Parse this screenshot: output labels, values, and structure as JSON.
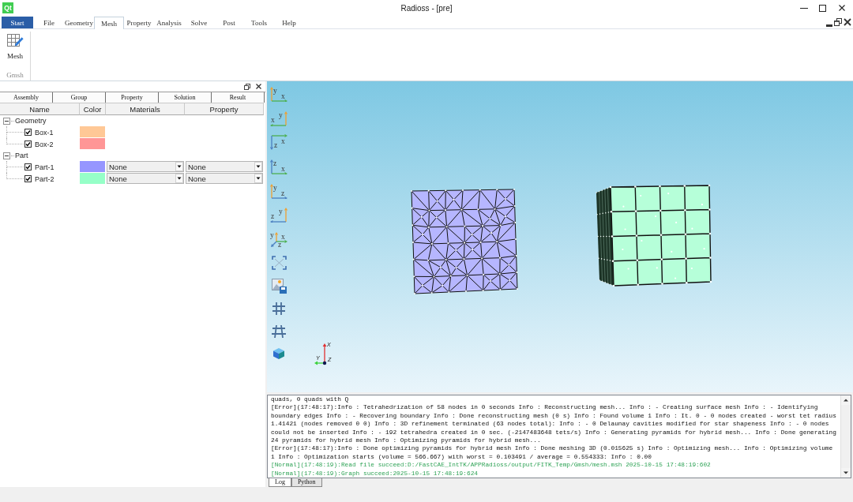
{
  "window": {
    "logo": "Qt",
    "title": "Radioss - [pre]"
  },
  "menu_tabs": [
    {
      "label": "Start",
      "kind": "app",
      "selected": false
    },
    {
      "label": "File",
      "kind": "tab",
      "selected": false
    },
    {
      "label": "Geometry",
      "kind": "tab",
      "selected": false
    },
    {
      "label": "Mesh",
      "kind": "tab",
      "selected": true
    },
    {
      "label": "Property",
      "kind": "tab",
      "selected": false
    },
    {
      "label": "Analysis",
      "kind": "tab",
      "selected": false
    },
    {
      "label": "Solve",
      "kind": "tab",
      "selected": false
    },
    {
      "label": "Post",
      "kind": "tab",
      "selected": false
    },
    {
      "label": "Tools",
      "kind": "tab",
      "selected": false
    },
    {
      "label": "Help",
      "kind": "tab",
      "selected": false
    }
  ],
  "ribbon": {
    "groups": [
      {
        "label": "Gmsh",
        "buttons": [
          {
            "label": "Mesh"
          }
        ]
      }
    ]
  },
  "side_panel": {
    "tabs": [
      "Assembly",
      "Group",
      "Property",
      "Solution",
      "Result"
    ],
    "columns": [
      "Name",
      "Color",
      "Materials",
      "Property"
    ],
    "tree": [
      {
        "label": "Geometry",
        "expanded": true,
        "children": [
          {
            "label": "Box-1",
            "checked": true,
            "color": "#ffc896"
          },
          {
            "label": "Box-2",
            "checked": true,
            "color": "#ff9696"
          }
        ]
      },
      {
        "label": "Part",
        "expanded": true,
        "children": [
          {
            "label": "Part-1",
            "checked": true,
            "color": "#9696ff",
            "material": "None",
            "property": "None"
          },
          {
            "label": "Part-2",
            "checked": true,
            "color": "#96ffc8",
            "material": "None",
            "property": "None"
          }
        ]
      }
    ]
  },
  "viewport": {
    "toolbar": [
      {
        "kind": "view",
        "labels": [
          "y",
          "x"
        ]
      },
      {
        "kind": "view",
        "labels": [
          "x",
          "y"
        ]
      },
      {
        "kind": "view",
        "labels": [
          "x",
          "z"
        ]
      },
      {
        "kind": "view",
        "labels": [
          "z",
          "x"
        ]
      },
      {
        "kind": "view",
        "labels": [
          "y",
          "z"
        ]
      },
      {
        "kind": "view",
        "labels": [
          "z",
          "y"
        ]
      },
      {
        "kind": "view",
        "labels": [
          "y",
          "x",
          "z"
        ]
      },
      {
        "kind": "fit"
      },
      {
        "kind": "snapshot"
      },
      {
        "kind": "grid"
      },
      {
        "kind": "perspective_grid"
      },
      {
        "kind": "cube"
      }
    ],
    "triad": {
      "labels": [
        "X",
        "Y",
        "Z"
      ]
    }
  },
  "log": {
    "entries": [
      {
        "kind": "plain",
        "text": "quads, 0 quads with Q"
      },
      {
        "kind": "error",
        "text": "[Error](17:48:17):Info : Tetrahedrization of 58 nodes in 0 seconds Info : Reconstructing mesh... Info : - Creating surface mesh Info : - Identifying boundary edges Info : - Recovering boundary Info : Done reconstructing mesh (0 s) Info : Found volume 1 Info : It. 0 - 0 nodes created - worst tet radius 1.41421 (nodes removed 0 0) Info : 3D refinement terminated (63 nodes total): Info : - 0 Delaunay cavities modified for star shapeness Info : - 0 nodes could not be inserted Info : - 192 tetrahedra created in 0 sec. (-2147483648 tets/s) Info : Generating pyramids for hybrid mesh... Info : Done generating 24 pyramids for hybrid mesh Info : Optimizing pyramids for hybrid mesh..."
      },
      {
        "kind": "error",
        "text": "[Error](17:48:17):Info : Done optimizing pyramids for hybrid mesh Info : Done meshing 3D (0.015625 s) Info : Optimizing mesh... Info : Optimizing volume 1 Info : Optimization starts (volume = 566.667) with worst = 0.103491 / average = 0.554333: Info : 0.00"
      },
      {
        "kind": "normal",
        "text": "[Normal](17:48:19):Read file succeed:D:/FastCAE_IntTK/APPRadioss/output/FITK_Temp/Gmsh/mesh.msh 2025-10-15 17:48:19:602"
      },
      {
        "kind": "normal",
        "text": "[Normal](17:48:19):Graph succeed:2025-10-15 17:48:19:624"
      }
    ],
    "tabs": [
      {
        "label": "Log",
        "selected": true
      },
      {
        "label": "Python",
        "selected": false
      }
    ]
  }
}
